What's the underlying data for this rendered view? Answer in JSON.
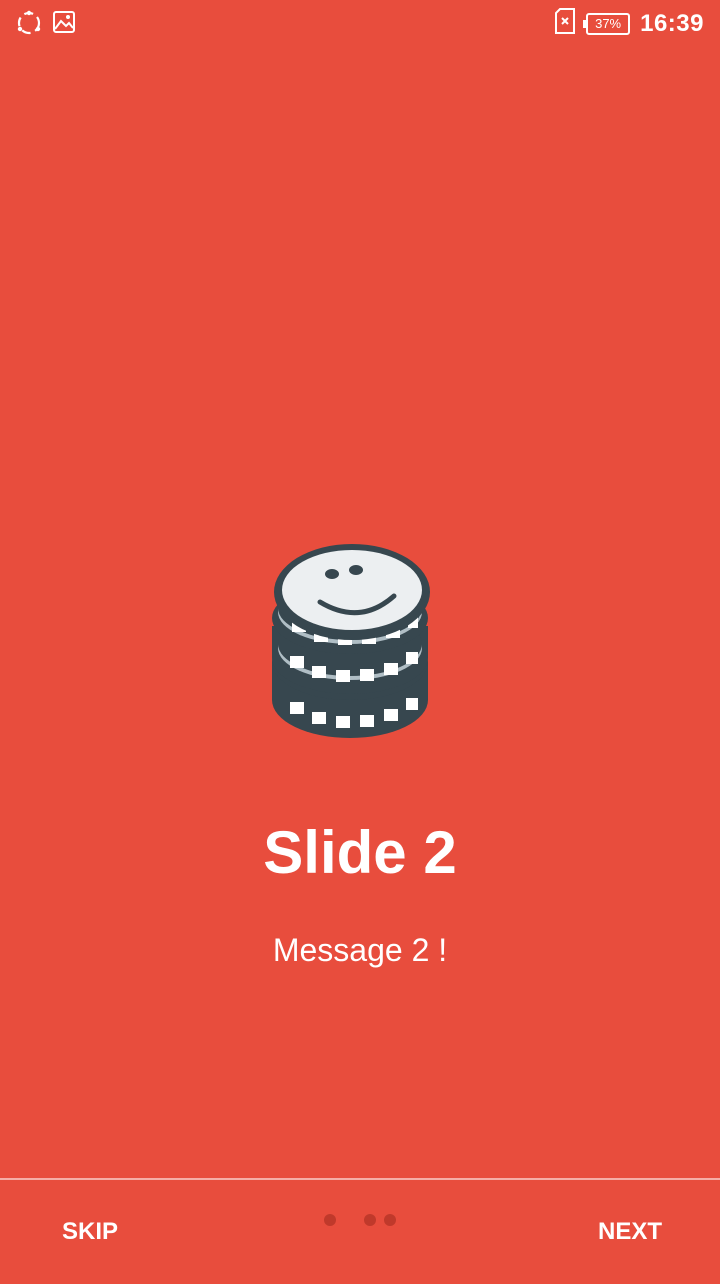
{
  "status_bar": {
    "time": "16:39",
    "battery_label": "37%",
    "icons": [
      "sync-icon",
      "image-icon",
      "sim-error-icon",
      "battery-icon"
    ]
  },
  "slide": {
    "icon": "poker-chips-smiley-icon",
    "title": "Slide 2",
    "message": "Message 2 !"
  },
  "footer": {
    "skip_label": "SKIP",
    "next_label": "NEXT",
    "page_count": 3,
    "current_page": 2
  },
  "colors": {
    "background": "#E84D3D",
    "dot": "#C0392B",
    "text": "#FFFFFF",
    "icon_dark": "#37474F"
  }
}
